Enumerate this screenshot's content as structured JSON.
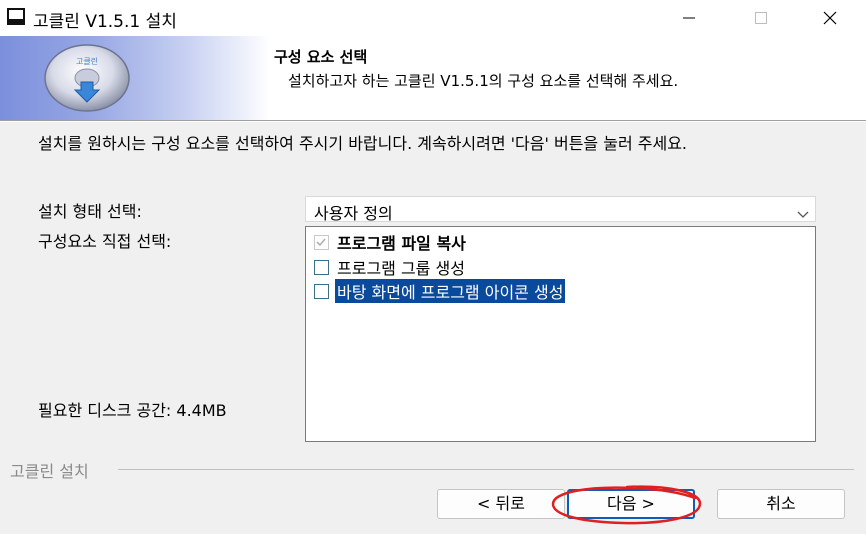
{
  "window": {
    "title": "고클린 V1.5.1 설치",
    "controls": [
      "minimize-icon",
      "maximize-icon",
      "close-icon"
    ]
  },
  "header": {
    "title": "구성 요소 선택",
    "subtitle": "설치하고자 하는 고클린 V1.5.1의 구성 요소를 선택해 주세요.",
    "logo_icon": "disk-download-icon",
    "logo_text": "고클린"
  },
  "body": {
    "description": "설치를 원하시는 구성 요소를 선택하여 주시기 바랍니다. 계속하시려면 '다음' 버튼을 눌러 주세요.",
    "install_type_label": "설치 형태 선택:",
    "install_type_value": "사용자 정의",
    "components_label": "구성요소 직접 선택:",
    "components": [
      {
        "label": "프로그램 파일 복사",
        "checked": true,
        "disabled": true,
        "bold": true
      },
      {
        "label": "프로그램 그룹 생성",
        "checked": false,
        "disabled": false,
        "bold": false
      },
      {
        "label": "바탕 화면에 프로그램 아이콘 생성",
        "checked": false,
        "disabled": false,
        "bold": false,
        "selected": true
      }
    ],
    "disk_space_label": "필요한 디스크 공간: 4.4MB"
  },
  "footer": {
    "brand": "고클린 설치",
    "back_label": "< 뒤로",
    "next_label": "다음 >",
    "cancel_label": "취소"
  },
  "colors": {
    "selection": "#0a4a9c",
    "default_button_border": "#0b5fba",
    "annotation_red": "#e02020"
  }
}
